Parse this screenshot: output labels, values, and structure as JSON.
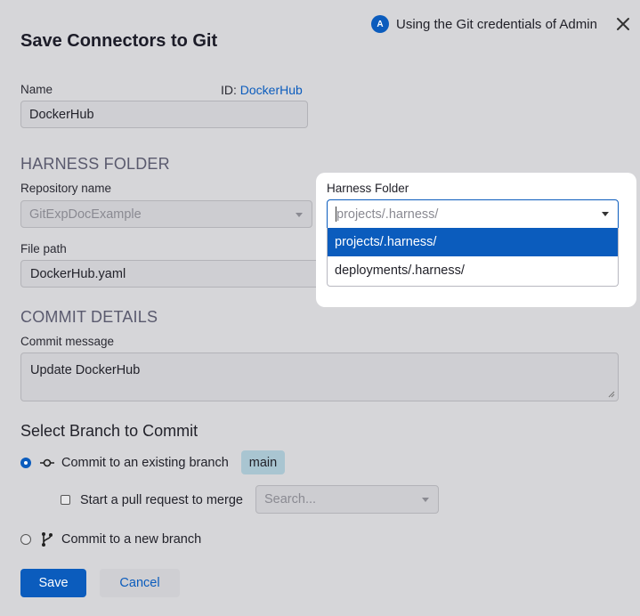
{
  "dialog": {
    "title": "Save Connectors to Git",
    "credentials_text": "Using the Git credentials of Admin",
    "avatar_initial": "A"
  },
  "name_field": {
    "label": "Name",
    "id_prefix": "ID:",
    "id_value": "DockerHub",
    "value": "DockerHub"
  },
  "harness_section": {
    "heading": "HARNESS FOLDER",
    "repo_label": "Repository name",
    "repo_value": "GitExpDocExample",
    "filepath_label": "File path",
    "filepath_value": "DockerHub.yaml"
  },
  "harness_folder_popup": {
    "label": "Harness Folder",
    "placeholder": "projects/.harness/",
    "options": [
      "projects/.harness/",
      "deployments/.harness/"
    ],
    "selected_index": 0
  },
  "commit_section": {
    "heading": "COMMIT DETAILS",
    "message_label": "Commit message",
    "message_value": "Update DockerHub"
  },
  "branch_section": {
    "heading": "Select Branch to Commit",
    "existing_label": "Commit to an existing branch",
    "existing_branch": "main",
    "pr_label": "Start a pull request to merge",
    "pr_placeholder": "Search...",
    "new_label": "Commit to a new branch",
    "selected": "existing"
  },
  "buttons": {
    "save": "Save",
    "cancel": "Cancel"
  },
  "colors": {
    "accent": "#0b5cbd",
    "overlay": "#d6d6d9",
    "branch_chip": "#a9c5d1"
  }
}
